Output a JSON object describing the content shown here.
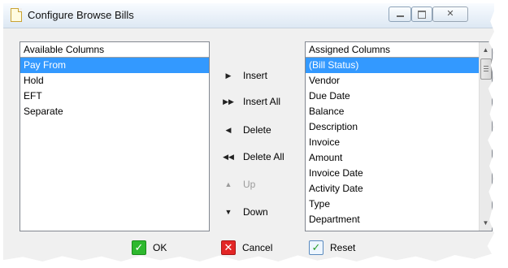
{
  "window": {
    "title": "Configure Browse Bills",
    "minimize_icon": "minimize-icon",
    "maximize_icon": "maximize-icon",
    "close_icon": "close-icon"
  },
  "available": {
    "header": "Available Columns",
    "items": [
      "Pay From",
      "Hold",
      "EFT",
      "Separate"
    ],
    "selected_index": 0
  },
  "assigned": {
    "header": "Assigned Columns",
    "items": [
      "(Bill Status)",
      "Vendor",
      "Due Date",
      "Balance",
      "Description",
      "Invoice",
      "Amount",
      "Invoice Date",
      "Activity Date",
      "Type",
      "Department"
    ],
    "selected_index": 0
  },
  "actions": {
    "insert": "Insert",
    "insert_all": "Insert All",
    "delete": "Delete",
    "delete_all": "Delete All",
    "up": "Up",
    "down": "Down"
  },
  "footer": {
    "ok": "OK",
    "cancel": "Cancel",
    "reset": "Reset"
  },
  "colors": {
    "selection": "#3399ff",
    "ok_icon": "#2eb82e",
    "cancel_icon": "#e32626"
  }
}
